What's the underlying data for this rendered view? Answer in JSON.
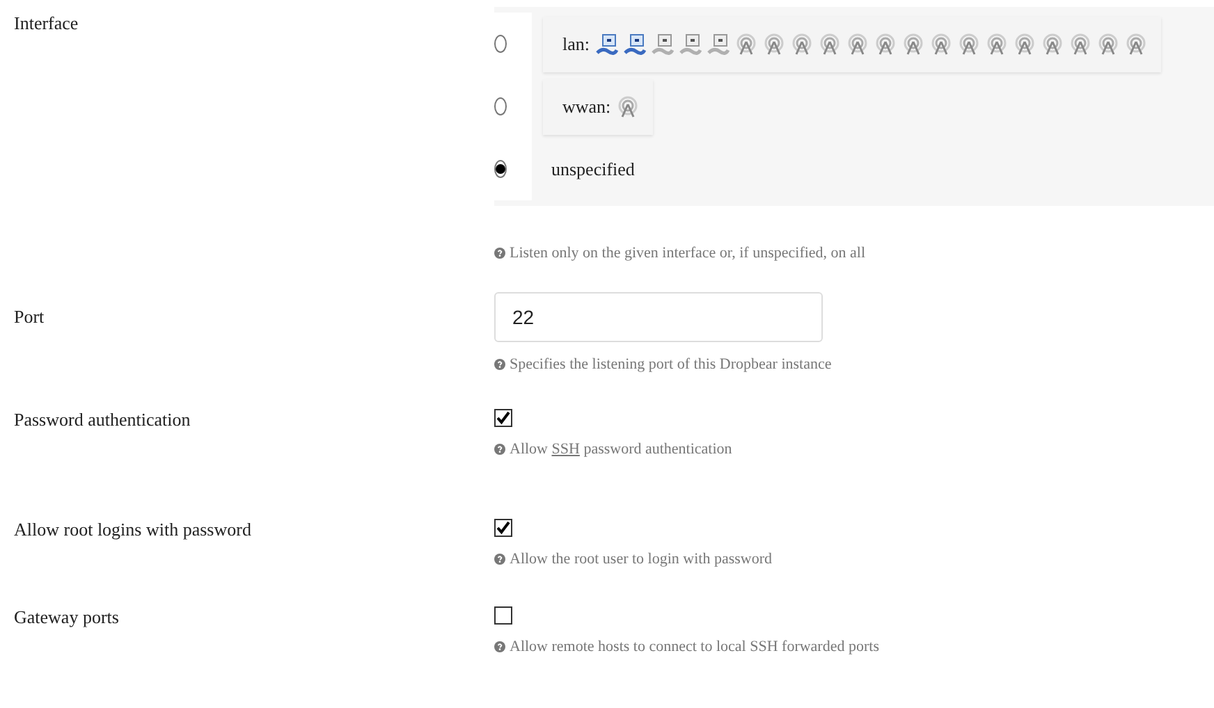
{
  "fields": [
    {
      "kind": "radios",
      "label": "Interface",
      "options": [
        {
          "label": "lan:",
          "selected": false,
          "icons": [
            {
              "kind": "ethernet",
              "up": true
            },
            {
              "kind": "ethernet",
              "up": true
            },
            {
              "kind": "ethernet",
              "up": false
            },
            {
              "kind": "ethernet",
              "up": false
            },
            {
              "kind": "ethernet",
              "up": false
            },
            {
              "kind": "wireless"
            },
            {
              "kind": "wireless"
            },
            {
              "kind": "wireless"
            },
            {
              "kind": "wireless"
            },
            {
              "kind": "wireless"
            },
            {
              "kind": "wireless"
            },
            {
              "kind": "wireless"
            },
            {
              "kind": "wireless"
            },
            {
              "kind": "wireless"
            },
            {
              "kind": "wireless"
            },
            {
              "kind": "wireless"
            },
            {
              "kind": "wireless"
            },
            {
              "kind": "wireless"
            },
            {
              "kind": "wireless"
            },
            {
              "kind": "wireless"
            }
          ]
        },
        {
          "label": "wwan:",
          "selected": false,
          "icons": [
            {
              "kind": "wireless"
            }
          ]
        },
        {
          "label": "unspecified",
          "selected": true
        }
      ],
      "help": [
        {
          "kind": "text",
          "text": "Listen only on the given interface or, if unspecified, on all"
        }
      ]
    },
    {
      "kind": "text",
      "label": "Port",
      "value": "22",
      "help": [
        {
          "kind": "text",
          "text": "Specifies the listening port of this Dropbear instance"
        }
      ]
    },
    {
      "kind": "checkbox",
      "label": "Password authentication",
      "checked": true,
      "help": [
        {
          "kind": "text",
          "text": "Allow "
        },
        {
          "kind": "abbr",
          "text": "SSH"
        },
        {
          "kind": "text",
          "text": " password authentication"
        }
      ]
    },
    {
      "kind": "checkbox",
      "label": "Allow root logins with password",
      "checked": true,
      "help": [
        {
          "kind": "text",
          "text": "Allow the root user to login with password"
        }
      ]
    },
    {
      "kind": "checkbox",
      "label": "Gateway ports",
      "checked": false,
      "help": [
        {
          "kind": "text",
          "text": "Allow remote hosts to connect to local SSH forwarded ports"
        }
      ]
    }
  ]
}
